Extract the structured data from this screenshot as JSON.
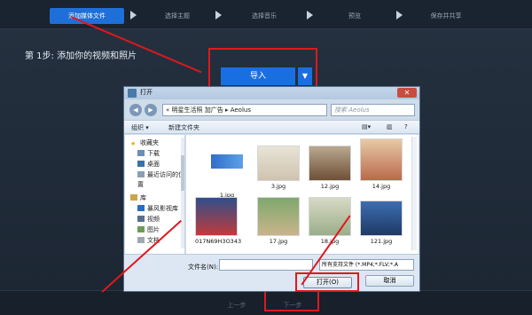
{
  "steps": [
    {
      "label": "添加媒体文件",
      "active": true
    },
    {
      "label": "选择主题",
      "active": false
    },
    {
      "label": "选择音乐",
      "active": false
    },
    {
      "label": "预览",
      "active": false
    },
    {
      "label": "保存并共享",
      "active": false
    }
  ],
  "heading": "第 1步: 添加你的视频和照片",
  "import": {
    "label": "导入",
    "dropdown": "▼"
  },
  "bottom": {
    "prev": "上一步",
    "next": "下一步"
  },
  "dialog": {
    "title": "打开",
    "close": "✕",
    "path": "«  明星生活照 加广告 ▸ Aeolus",
    "search_placeholder": "搜索 Aeolus",
    "toolbar": {
      "organize": "组织 ▾",
      "new_folder": "新建文件夹"
    },
    "nav": {
      "favorites": "收藏夹",
      "downloads": "下载",
      "desktop": "桌面",
      "recent": "最近访问的位置",
      "libraries": "库",
      "storm": "暴风影视库",
      "videos": "视频",
      "pictures": "图片",
      "documents": "文档"
    },
    "files": [
      "1.jpg",
      "3.jpg",
      "12.jpg",
      "14.jpg",
      "017N69H3O343",
      "17.jpg",
      "18.jpg",
      "121.jpg"
    ],
    "filename_label": "文件名(N):",
    "filename_value": "",
    "filetype": "所有支持文件 (*.MP4;*.FLV;*.A",
    "open": "打开(O)",
    "cancel": "取消"
  },
  "colors": {
    "accent": "#1a6fe0",
    "highlight": "#e0181d"
  }
}
